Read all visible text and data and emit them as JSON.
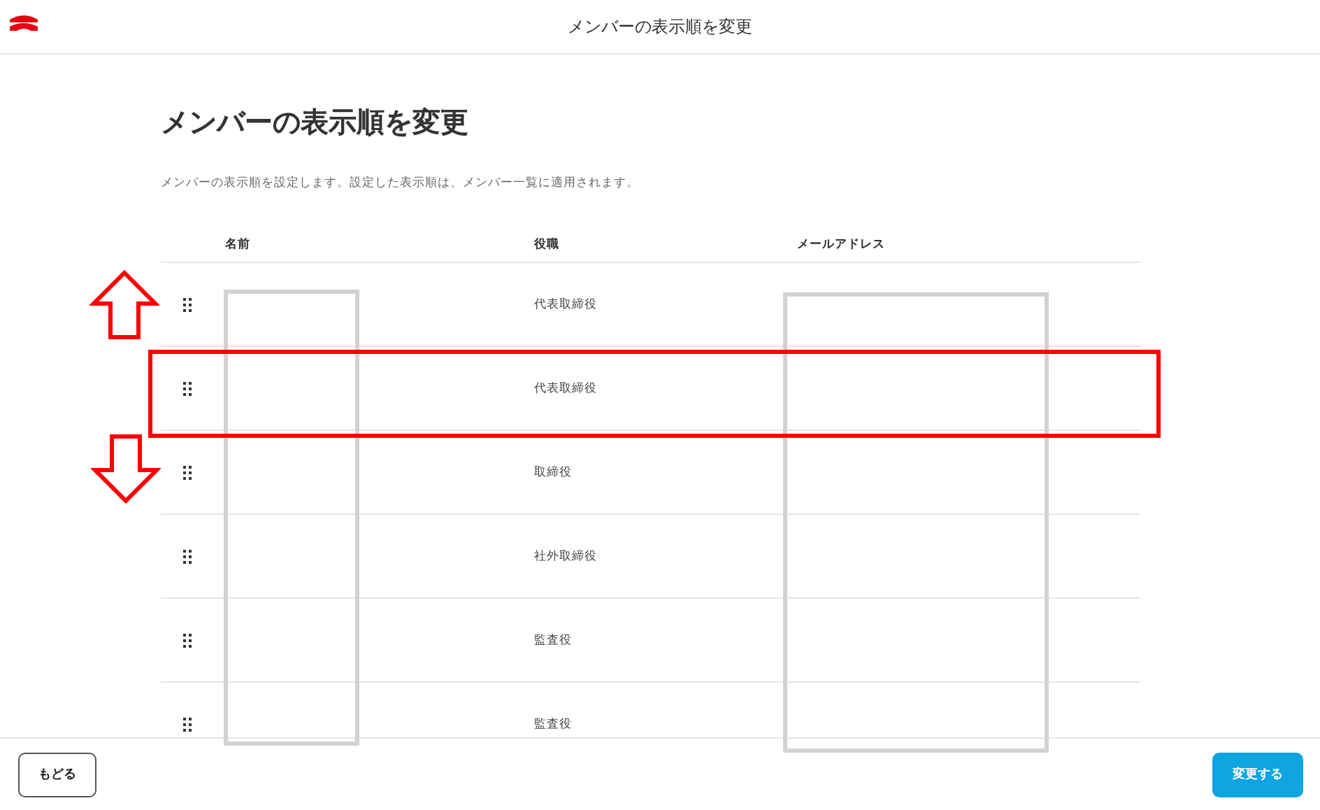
{
  "header": {
    "title": "メンバーの表示順を変更"
  },
  "page": {
    "heading": "メンバーの表示順を変更",
    "description": "メンバーの表示順を設定します。設定した表示順は、メンバー一覧に適用されます。"
  },
  "table": {
    "columns": [
      "名前",
      "役職",
      "メールアドレス"
    ],
    "rows": [
      {
        "role": "代表取締役",
        "highlighted": false
      },
      {
        "role": "代表取締役",
        "highlighted": true
      },
      {
        "role": "取締役",
        "highlighted": false
      },
      {
        "role": "社外取締役",
        "highlighted": false
      },
      {
        "role": "監査役",
        "highlighted": false
      },
      {
        "role": "監査役",
        "highlighted": false
      }
    ]
  },
  "footer": {
    "back_button": "もどる",
    "submit_button": "変更する"
  }
}
